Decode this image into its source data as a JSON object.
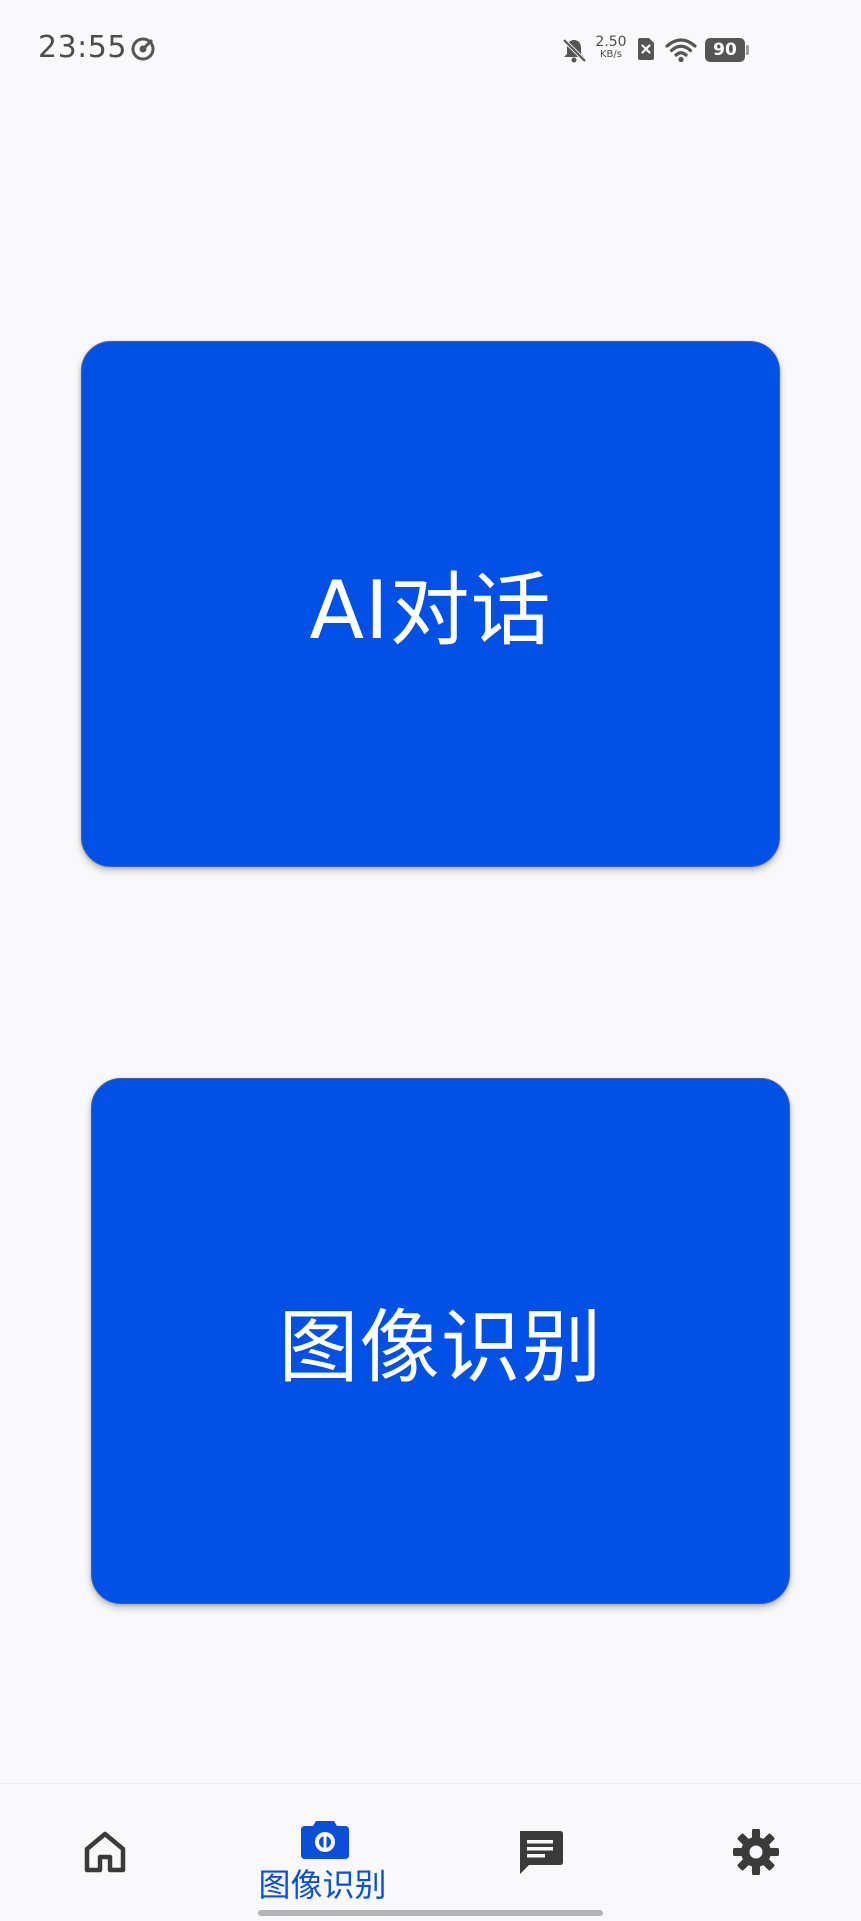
{
  "status_bar": {
    "time": "23:55",
    "net_speed_value": "2.50",
    "net_speed_unit": "KB/s",
    "battery": "90",
    "icons": [
      "app-sync-icon",
      "bell-off-icon",
      "sim-x-icon",
      "wifi-icon",
      "battery-icon"
    ]
  },
  "main": {
    "card_ai_label": "AI对话",
    "card_image_label": "图像识别",
    "card_color": "#0050e6"
  },
  "bottom_nav": {
    "active_label": "图像识别",
    "active_color": "#0a4fd6",
    "items": [
      {
        "icon": "home-icon",
        "active": false
      },
      {
        "icon": "camera-icon",
        "active": true
      },
      {
        "icon": "chat-icon",
        "active": false
      },
      {
        "icon": "gear-icon",
        "active": false
      }
    ]
  }
}
